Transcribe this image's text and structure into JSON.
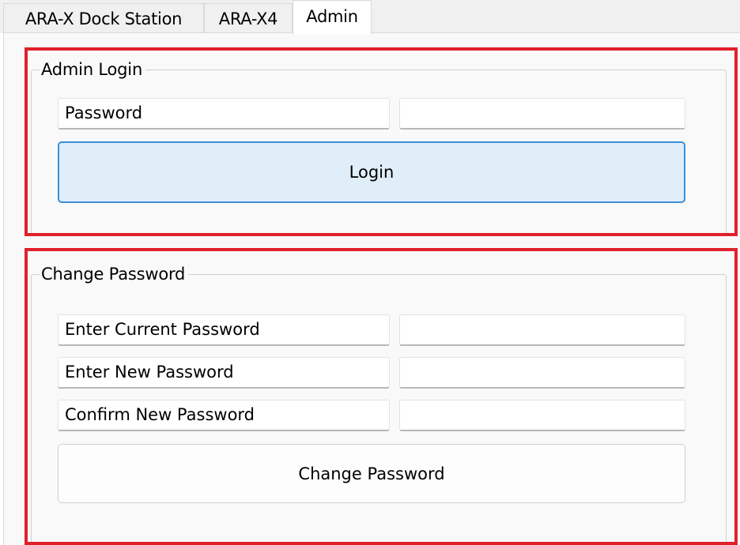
{
  "tabs": [
    {
      "label": "ARA-X Dock Station",
      "active": false
    },
    {
      "label": "ARA-X4",
      "active": false
    },
    {
      "label": "Admin",
      "active": true
    }
  ],
  "admin_login": {
    "title": "Admin Login",
    "password_label": "Password",
    "password_value": "",
    "login_button": "Login"
  },
  "change_password": {
    "title": "Change Password",
    "current_label": "Enter Current Password",
    "current_value": "",
    "new_label": "Enter New Password",
    "new_value": "",
    "confirm_label": "Confirm New Password",
    "confirm_value": "",
    "change_button": "Change Password"
  },
  "colors": {
    "highlight": "#e0212c",
    "login_button_fill": "#e0eef9",
    "login_button_border": "#3c8ed8"
  }
}
